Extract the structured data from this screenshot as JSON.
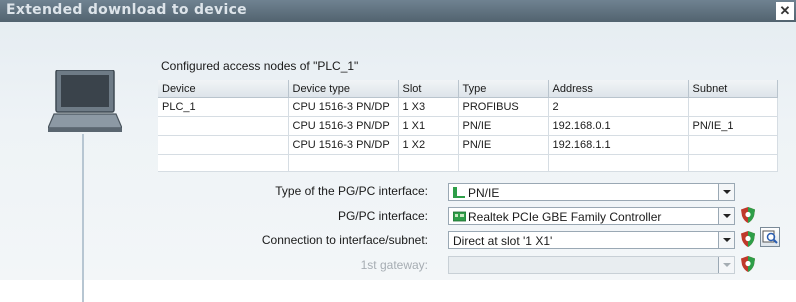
{
  "window": {
    "title": "Extended download to device",
    "close_glyph": "✕"
  },
  "section_title": "Configured access nodes of \"PLC_1\"",
  "table": {
    "headers": [
      "Device",
      "Device type",
      "Slot",
      "Type",
      "Address",
      "Subnet"
    ],
    "rows": [
      [
        "PLC_1",
        "CPU 1516-3 PN/DP",
        "1 X3",
        "PROFIBUS",
        "2",
        ""
      ],
      [
        "",
        "CPU 1516-3 PN/DP",
        "1 X1",
        "PN/IE",
        "192.168.0.1",
        "PN/IE_1"
      ],
      [
        "",
        "CPU 1516-3 PN/DP",
        "1 X2",
        "PN/IE",
        "192.168.1.1",
        ""
      ],
      [
        "",
        "",
        "",
        "",
        "",
        ""
      ]
    ]
  },
  "form": {
    "pgpc_type_label": "Type of the PG/PC interface:",
    "pgpc_type_value": "PN/IE",
    "pgpc_interface_label": "PG/PC interface:",
    "pgpc_interface_value": "Realtek PCIe GBE Family Controller",
    "connection_label": "Connection to interface/subnet:",
    "connection_value": "Direct at slot '1 X1'",
    "gateway_label": "1st gateway:",
    "gateway_value": ""
  },
  "colors": {
    "titlebar": "#5e707d",
    "panel": "#e9eff3",
    "shield_red": "#c0392b",
    "shield_green": "#2e9e48"
  },
  "icons": [
    "close-icon",
    "laptop-icon",
    "network-icon",
    "network-card-icon",
    "security-shield-icon",
    "properties-icon"
  ]
}
